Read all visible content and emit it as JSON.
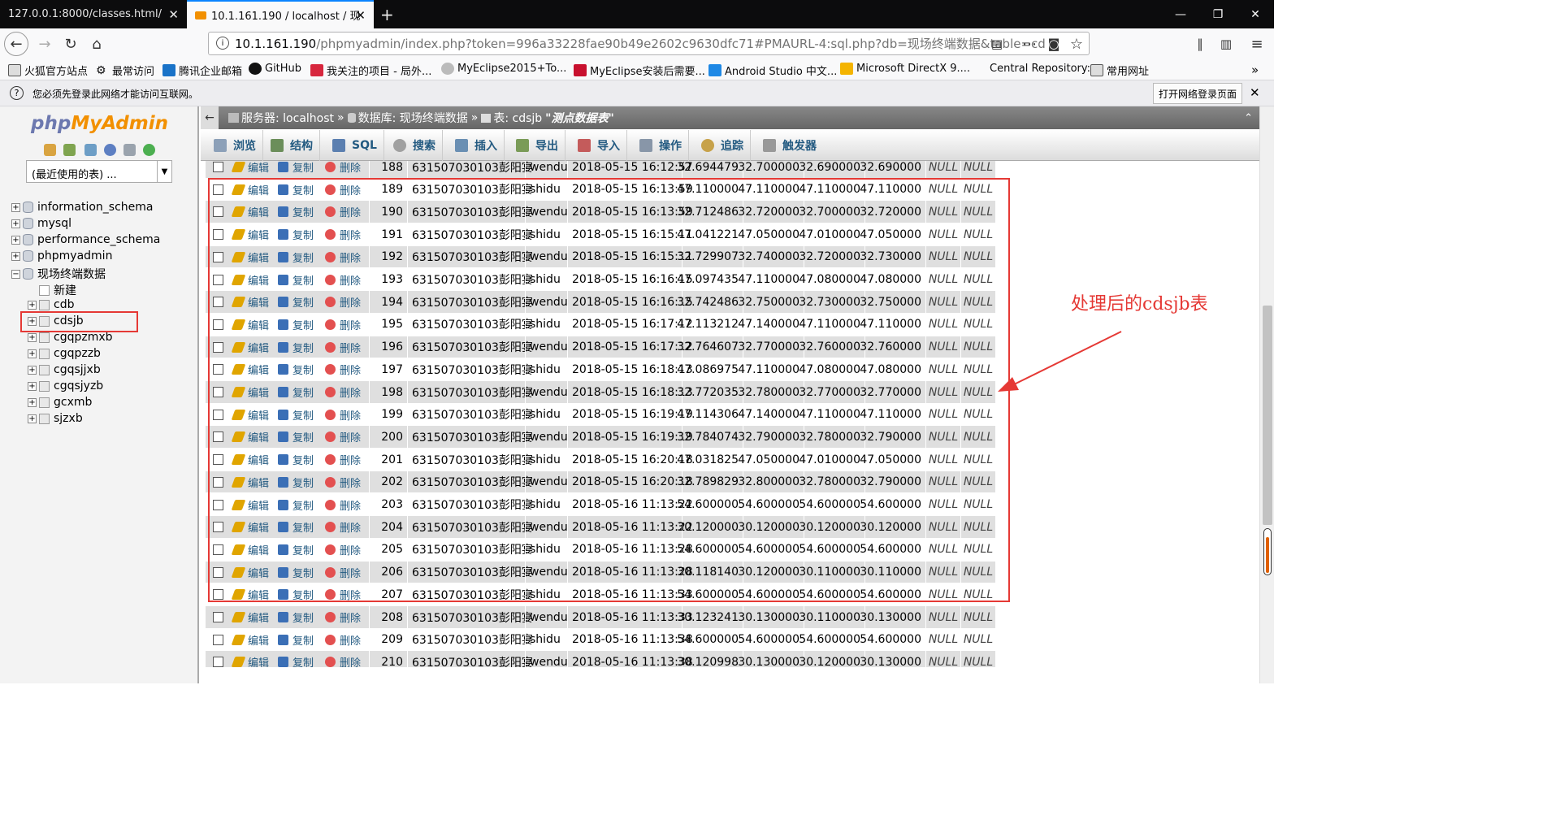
{
  "browser": {
    "tabs": [
      {
        "label": "127.0.0.1:8000/classes.html/",
        "active": false
      },
      {
        "label": "10.1.161.190 / localhost / 现",
        "active": true
      }
    ],
    "new_tab": "+",
    "window_buttons": {
      "min": "—",
      "max": "❐",
      "close": "✕"
    },
    "url_host": "10.1.161.190",
    "url_rest": "/phpmyadmin/index.php?token=996a33228fae90b49e2602c9630dfc71#PMAURL-4:sql.php?db=现场终端数据&table=cd",
    "bookmarks": [
      "火狐官方站点",
      "最常访问",
      "腾讯企业邮箱",
      "GitHub",
      "我关注的项目 - 局外...",
      "MyEclipse2015+To...",
      "MyEclipse安装后需要...",
      "Android Studio 中文...",
      "Microsoft DirectX 9....",
      "Central Repository:",
      "常用网址"
    ],
    "notice": "您必须先登录此网络才能访问互联网。",
    "login_button": "打开网络登录页面"
  },
  "sidebar": {
    "logo_php": "php",
    "logo_ma": "MyAdmin",
    "recent_select": "(最近使用的表) ...",
    "databases": [
      "information_schema",
      "mysql",
      "performance_schema",
      "phpmyadmin",
      "现场终端数据"
    ],
    "new_item": "新建",
    "tables": [
      "cdb",
      "cdsjb",
      "cgqpzmxb",
      "cgqpzzb",
      "cgqsjjxb",
      "cgqsjyzb",
      "gcxmb",
      "sjzxb"
    ],
    "highlighted_table": "cdsjb"
  },
  "breadcrumb": {
    "server": "服务器: localhost",
    "database": "数据库: 现场终端数据",
    "table": "表: cdsjb",
    "comment": "\"测点数据表\""
  },
  "menu": [
    "浏览",
    "结构",
    "SQL",
    "搜索",
    "插入",
    "导出",
    "导入",
    "操作",
    "追踪",
    "触发器"
  ],
  "actions": {
    "edit": "编辑",
    "copy": "复制",
    "delete": "删除"
  },
  "rows": [
    {
      "id": "188",
      "device": "631507030103彭阳宴",
      "type": "wendu",
      "time": "2018-05-15 16:12:57",
      "v1": "32.694479",
      "v2": "32.700000",
      "v3": "32.690000",
      "v4": "32.690000",
      "n1": "NULL",
      "n2": "NULL"
    },
    {
      "id": "189",
      "device": "631507030103彭阳宴",
      "type": "shidu",
      "time": "2018-05-15 16:13:59",
      "v1": "47.110000",
      "v2": "47.110000",
      "v3": "47.110000",
      "v4": "47.110000",
      "n1": "NULL",
      "n2": "NULL"
    },
    {
      "id": "190",
      "device": "631507030103彭阳宴",
      "type": "wendu",
      "time": "2018-05-15 16:13:59",
      "v1": "32.712486",
      "v2": "32.720000",
      "v3": "32.700000",
      "v4": "32.720000",
      "n1": "NULL",
      "n2": "NULL"
    },
    {
      "id": "191",
      "device": "631507030103彭阳宴",
      "type": "shidu",
      "time": "2018-05-15 16:15:11",
      "v1": "47.041221",
      "v2": "47.050000",
      "v3": "47.010000",
      "v4": "47.050000",
      "n1": "NULL",
      "n2": "NULL"
    },
    {
      "id": "192",
      "device": "631507030103彭阳宴",
      "type": "wendu",
      "time": "2018-05-15 16:15:11",
      "v1": "32.729907",
      "v2": "32.740000",
      "v3": "32.720000",
      "v4": "32.730000",
      "n1": "NULL",
      "n2": "NULL"
    },
    {
      "id": "193",
      "device": "631507030103彭阳宴",
      "type": "shidu",
      "time": "2018-05-15 16:16:15",
      "v1": "47.097435",
      "v2": "47.110000",
      "v3": "47.080000",
      "v4": "47.080000",
      "n1": "NULL",
      "n2": "NULL"
    },
    {
      "id": "194",
      "device": "631507030103彭阳宴",
      "type": "wendu",
      "time": "2018-05-15 16:16:15",
      "v1": "32.742486",
      "v2": "32.750000",
      "v3": "32.730000",
      "v4": "32.750000",
      "n1": "NULL",
      "n2": "NULL"
    },
    {
      "id": "195",
      "device": "631507030103彭阳宴",
      "type": "shidu",
      "time": "2018-05-15 16:17:12",
      "v1": "47.113212",
      "v2": "47.140000",
      "v3": "47.110000",
      "v4": "47.110000",
      "n1": "NULL",
      "n2": "NULL"
    },
    {
      "id": "196",
      "device": "631507030103彭阳宴",
      "type": "wendu",
      "time": "2018-05-15 16:17:12",
      "v1": "32.764607",
      "v2": "32.770000",
      "v3": "32.760000",
      "v4": "32.760000",
      "n1": "NULL",
      "n2": "NULL"
    },
    {
      "id": "197",
      "device": "631507030103彭阳宴",
      "type": "shidu",
      "time": "2018-05-15 16:18:13",
      "v1": "47.086975",
      "v2": "47.110000",
      "v3": "47.080000",
      "v4": "47.080000",
      "n1": "NULL",
      "n2": "NULL"
    },
    {
      "id": "198",
      "device": "631507030103彭阳宴",
      "type": "wendu",
      "time": "2018-05-15 16:18:13",
      "v1": "32.772035",
      "v2": "32.780000",
      "v3": "32.770000",
      "v4": "32.770000",
      "n1": "NULL",
      "n2": "NULL"
    },
    {
      "id": "199",
      "device": "631507030103彭阳宴",
      "type": "shidu",
      "time": "2018-05-15 16:19:19",
      "v1": "47.114306",
      "v2": "47.140000",
      "v3": "47.110000",
      "v4": "47.110000",
      "n1": "NULL",
      "n2": "NULL"
    },
    {
      "id": "200",
      "device": "631507030103彭阳宴",
      "type": "wendu",
      "time": "2018-05-15 16:19:19",
      "v1": "32.784074",
      "v2": "32.790000",
      "v3": "32.780000",
      "v4": "32.790000",
      "n1": "NULL",
      "n2": "NULL"
    },
    {
      "id": "201",
      "device": "631507030103彭阳宴",
      "type": "shidu",
      "time": "2018-05-15 16:20:18",
      "v1": "47.031825",
      "v2": "47.050000",
      "v3": "47.010000",
      "v4": "47.050000",
      "n1": "NULL",
      "n2": "NULL"
    },
    {
      "id": "202",
      "device": "631507030103彭阳宴",
      "type": "wendu",
      "time": "2018-05-15 16:20:18",
      "v1": "32.789829",
      "v2": "32.800000",
      "v3": "32.780000",
      "v4": "32.790000",
      "n1": "NULL",
      "n2": "NULL"
    },
    {
      "id": "203",
      "device": "631507030103彭阳宴",
      "type": "shidu",
      "time": "2018-05-16 11:13:22",
      "v1": "54.600000",
      "v2": "54.600000",
      "v3": "54.600000",
      "v4": "54.600000",
      "n1": "NULL",
      "n2": "NULL"
    },
    {
      "id": "204",
      "device": "631507030103彭阳宴",
      "type": "wendu",
      "time": "2018-05-16 11:13:22",
      "v1": "30.120000",
      "v2": "30.120000",
      "v3": "30.120000",
      "v4": "30.120000",
      "n1": "NULL",
      "n2": "NULL"
    },
    {
      "id": "205",
      "device": "631507030103彭阳宴",
      "type": "shidu",
      "time": "2018-05-16 11:13:28",
      "v1": "54.600000",
      "v2": "54.600000",
      "v3": "54.600000",
      "v4": "54.600000",
      "n1": "NULL",
      "n2": "NULL"
    },
    {
      "id": "206",
      "device": "631507030103彭阳宴",
      "type": "wendu",
      "time": "2018-05-16 11:13:28",
      "v1": "30.118140",
      "v2": "30.120000",
      "v3": "30.110000",
      "v4": "30.110000",
      "n1": "NULL",
      "n2": "NULL"
    },
    {
      "id": "207",
      "device": "631507030103彭阳宴",
      "type": "shidu",
      "time": "2018-05-16 11:13:33",
      "v1": "54.600000",
      "v2": "54.600000",
      "v3": "54.600000",
      "v4": "54.600000",
      "n1": "NULL",
      "n2": "NULL"
    },
    {
      "id": "208",
      "device": "631507030103彭阳宴",
      "type": "wendu",
      "time": "2018-05-16 11:13:33",
      "v1": "30.123241",
      "v2": "30.130000",
      "v3": "30.110000",
      "v4": "30.130000",
      "n1": "NULL",
      "n2": "NULL"
    },
    {
      "id": "209",
      "device": "631507030103彭阳宴",
      "type": "shidu",
      "time": "2018-05-16 11:13:38",
      "v1": "54.600000",
      "v2": "54.600000",
      "v3": "54.600000",
      "v4": "54.600000",
      "n1": "NULL",
      "n2": "NULL"
    },
    {
      "id": "210",
      "device": "631507030103彭阳宴",
      "type": "wendu",
      "time": "2018-05-16 11:13:38",
      "v1": "30.120998",
      "v2": "30.130000",
      "v3": "30.120000",
      "v4": "30.130000",
      "n1": "NULL",
      "n2": "NULL"
    }
  ],
  "annotation": "处理后的cdsjb表",
  "annotation_color": "#e53935"
}
